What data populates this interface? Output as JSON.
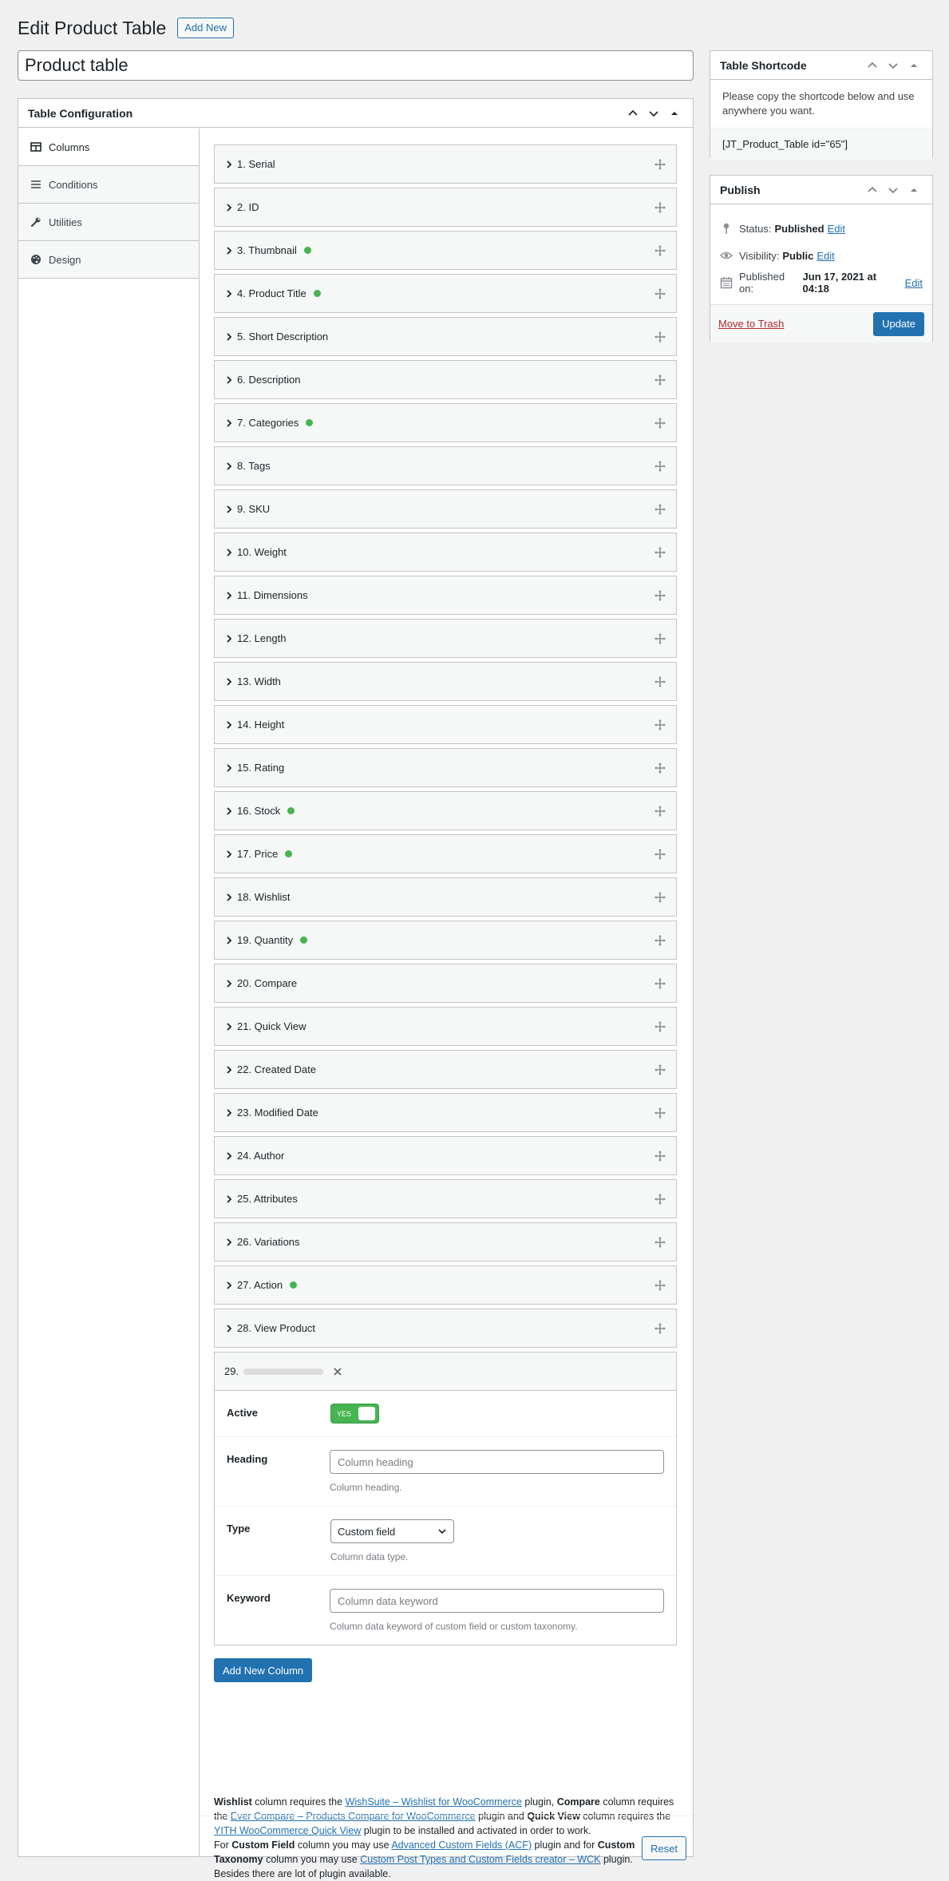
{
  "header": {
    "title": "Edit Product Table",
    "add_new": "Add New"
  },
  "post_title": "Product table",
  "config": {
    "title": "Table Configuration",
    "tabs": [
      {
        "label": "Columns",
        "icon": "table-icon",
        "active": true
      },
      {
        "label": "Conditions",
        "icon": "list-icon",
        "active": false
      },
      {
        "label": "Utilities",
        "icon": "wrench-icon",
        "active": false
      },
      {
        "label": "Design",
        "icon": "palette-icon",
        "active": false
      }
    ],
    "columns": [
      {
        "label": "1. Serial",
        "active": false
      },
      {
        "label": "2. ID",
        "active": false
      },
      {
        "label": "3. Thumbnail",
        "active": true
      },
      {
        "label": "4. Product Title",
        "active": true
      },
      {
        "label": "5. Short Description",
        "active": false
      },
      {
        "label": "6. Description",
        "active": false
      },
      {
        "label": "7. Categories",
        "active": true
      },
      {
        "label": "8. Tags",
        "active": false
      },
      {
        "label": "9. SKU",
        "active": false
      },
      {
        "label": "10. Weight",
        "active": false
      },
      {
        "label": "11. Dimensions",
        "active": false
      },
      {
        "label": "12. Length",
        "active": false
      },
      {
        "label": "13. Width",
        "active": false
      },
      {
        "label": "14. Height",
        "active": false
      },
      {
        "label": "15. Rating",
        "active": false
      },
      {
        "label": "16. Stock",
        "active": true
      },
      {
        "label": "17. Price",
        "active": true
      },
      {
        "label": "18. Wishlist",
        "active": false
      },
      {
        "label": "19. Quantity",
        "active": true
      },
      {
        "label": "20. Compare",
        "active": false
      },
      {
        "label": "21. Quick View",
        "active": false
      },
      {
        "label": "22. Created Date",
        "active": false
      },
      {
        "label": "23. Modified Date",
        "active": false
      },
      {
        "label": "24. Author",
        "active": false
      },
      {
        "label": "25. Attributes",
        "active": false
      },
      {
        "label": "26. Variations",
        "active": false
      },
      {
        "label": "27. Action",
        "active": true
      },
      {
        "label": "28. View Product",
        "active": false
      }
    ],
    "open_column": {
      "number": "29.",
      "active_label": "Active",
      "toggle_text": "YES",
      "heading_label": "Heading",
      "heading_placeholder": "Column heading",
      "heading_help": "Column heading.",
      "type_label": "Type",
      "type_value": "Custom field",
      "type_help": "Column data type.",
      "keyword_label": "Keyword",
      "keyword_placeholder": "Column data keyword",
      "keyword_help": "Column data keyword of custom field or custom taxonomy."
    },
    "add_column": "Add New Column",
    "notes": {
      "p1_a": "Wishlist",
      "p1_b": " column requires the ",
      "p1_link1": "WishSuite – Wishlist for WooCommerce",
      "p1_c": " plugin, ",
      "p1_d": "Compare",
      "p1_e": " column requires the ",
      "p1_link2": "Ever Compare – Products Compare for WooCommerce",
      "p1_f": " plugin and ",
      "p1_g": "Quick View",
      "p1_h": " column requires the ",
      "p1_link3": "YITH WooCommerce Quick View",
      "p1_i": " plugin to be installed and activated in order to work.",
      "p2_a": "For ",
      "p2_b": "Custom Field",
      "p2_c": " column you may use ",
      "p2_link1": "Advanced Custom Fields (ACF)",
      "p2_d": " plugin and for ",
      "p2_e": "Custom Taxonomy",
      "p2_f": " column you may use ",
      "p2_link2": "Custom Post Types and Custom Fields creator – WCK",
      "p2_g": " plugin.",
      "p3": "Besides there are lot of plugin available."
    },
    "reset": "Reset"
  },
  "shortcode": {
    "title": "Table Shortcode",
    "description": "Please copy the shortcode below and use anywhere you want.",
    "code": "[JT_Product_Table id=\"65\"]"
  },
  "publish": {
    "title": "Publish",
    "status_label": "Status:",
    "status_value": "Published",
    "visibility_label": "Visibility:",
    "visibility_value": "Public",
    "published_label": "Published on:",
    "published_value": "Jun 17, 2021 at 04:18",
    "edit": "Edit",
    "trash": "Move to Trash",
    "update": "Update"
  },
  "colors": {
    "primary": "#2271b1",
    "active_dot": "#46b450",
    "trash": "#b32d2e"
  }
}
